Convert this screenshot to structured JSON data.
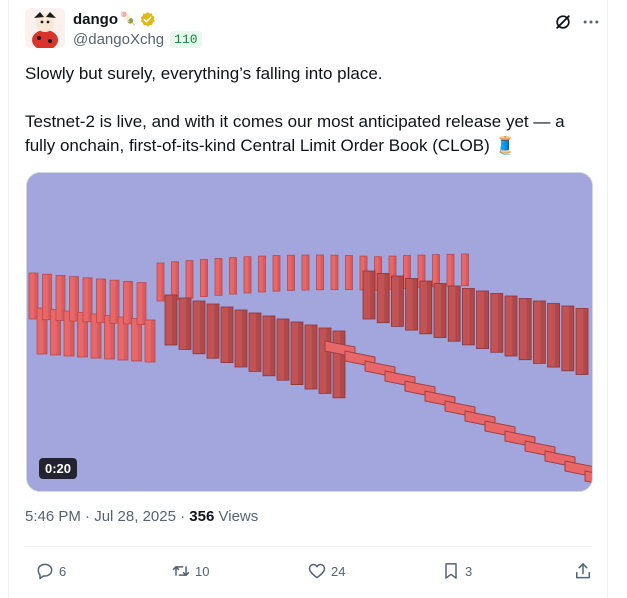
{
  "author": {
    "display_name": "dango",
    "name_emoji": "🍡",
    "handle": "@dangoXchg",
    "affiliation_badge": "110",
    "verified_color": "#e2b719"
  },
  "tweet": {
    "text_line1": "Slowly but surely, everything’s falling into place.",
    "text_para2": "Testnet-2 is live, and with it comes our most anticipated release yet — a fully onchain, first-of-its-kind Central Limit Order Book (CLOB) 🧵"
  },
  "media": {
    "type": "video",
    "duration": "0:20",
    "background_color": "#a3a6dc",
    "domino_color": "#e8686a"
  },
  "meta": {
    "time": "5:46 PM",
    "separator": "·",
    "date": "Jul 28, 2025",
    "views_count": "356",
    "views_label": "Views"
  },
  "actions": {
    "replies": "6",
    "reposts": "10",
    "likes": "24",
    "bookmarks": "3"
  },
  "colors": {
    "text_primary": "#0f1419",
    "text_secondary": "#536471",
    "border": "#eff3f4"
  }
}
